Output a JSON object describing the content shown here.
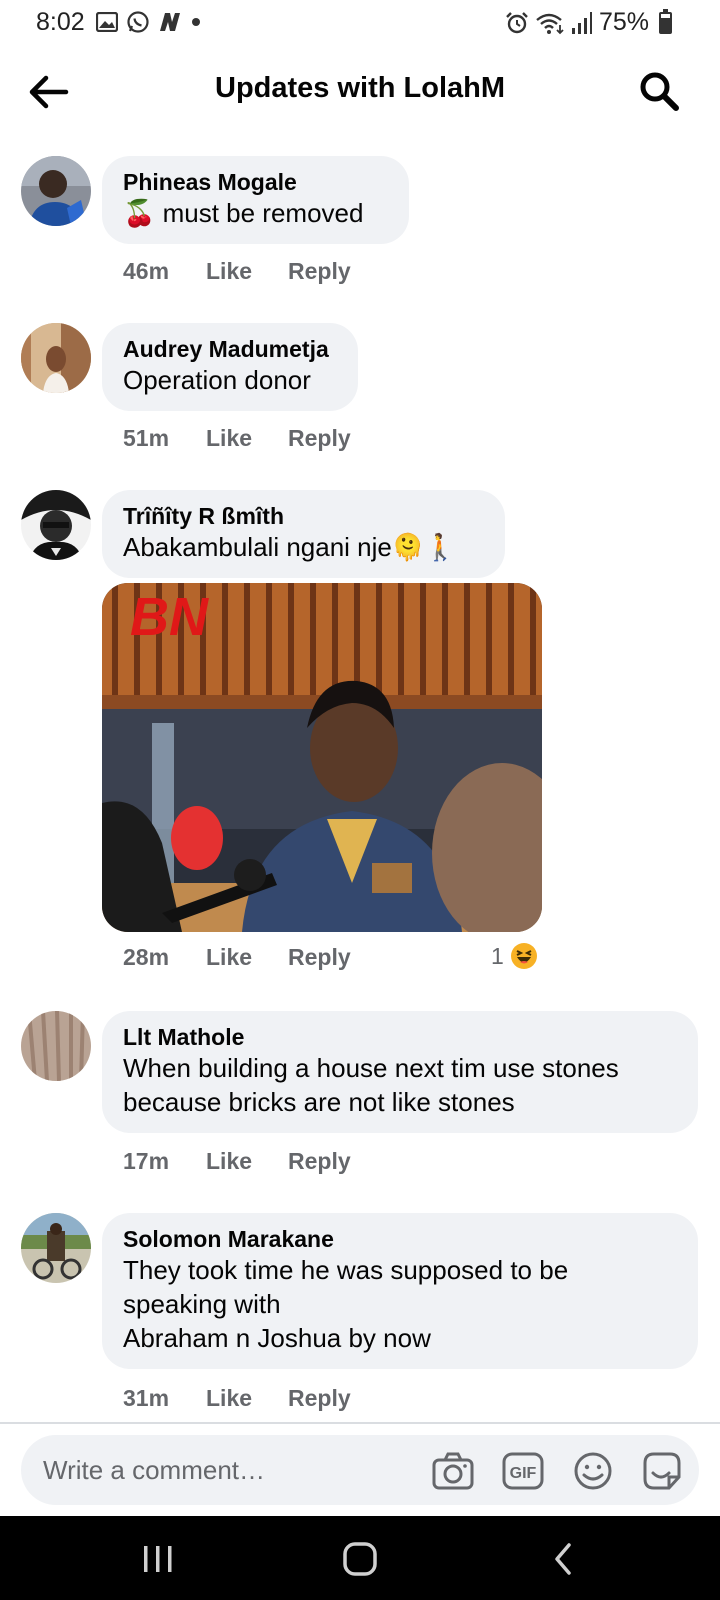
{
  "status_bar": {
    "time": "8:02",
    "battery": "75%",
    "left_icons": [
      "gallery-icon",
      "whatsapp-icon",
      "n-app-icon",
      "dot-icon"
    ],
    "right_icons": [
      "alarm-icon",
      "wifi-icon",
      "signal-icon",
      "battery-icon"
    ]
  },
  "header": {
    "title": "Updates with LolahM",
    "back_icon": "arrow-left-icon",
    "search_icon": "search-icon"
  },
  "comments": [
    {
      "name": "Phineas Mogale",
      "text": "🍒 must be removed",
      "time": "46m",
      "like": "Like",
      "reply": "Reply"
    },
    {
      "name": "Audrey Madumetja",
      "text": "Operation donor",
      "time": "51m",
      "like": "Like",
      "reply": "Reply"
    },
    {
      "name": "Trîñîty R ßmîth",
      "text": "Abakambulali ngani nje🫠🚶",
      "time": "28m",
      "like": "Like",
      "reply": "Reply",
      "reaction_count": "1",
      "image_logo": "BN"
    },
    {
      "name": "Llt Mathole",
      "text_lines": [
        "When building  a house next tim use stones",
        "because bricks are not like stones"
      ],
      "time": "17m",
      "like": "Like",
      "reply": "Reply"
    },
    {
      "name": "Solomon Marakane",
      "text_lines": [
        "They took time he was supposed to be",
        "speaking with",
        "Abraham n Joshua by now"
      ],
      "time": "31m",
      "like": "Like",
      "reply": "Reply"
    }
  ],
  "composer": {
    "placeholder": "Write a comment…",
    "icons": [
      "camera-icon",
      "gif-icon",
      "emoji-icon",
      "sticker-icon"
    ]
  },
  "colors": {
    "bubble": "#f0f2f5",
    "meta_text": "#65676b",
    "primary_text": "#050505",
    "nav_bar": "#000000"
  }
}
